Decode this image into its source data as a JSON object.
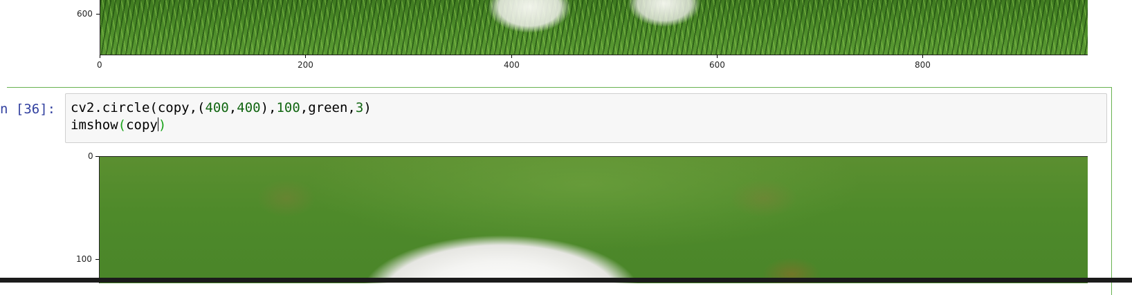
{
  "top_plot": {
    "y_tick_labels": [
      "600"
    ],
    "x_tick_labels": [
      "0",
      "200",
      "400",
      "600",
      "800"
    ]
  },
  "cell": {
    "prompt": "n [36]:",
    "line1_parts": {
      "p1": "cv2.circle(copy,(",
      "n1": "400",
      "c1": ",",
      "n2": "400",
      "p2": "),",
      "n3": "100",
      "p3": ",green,",
      "n4": "3",
      "p4": ")"
    },
    "line2_parts": {
      "func": "imshow",
      "open": "(",
      "arg": "copy",
      "close": ")"
    }
  },
  "bottom_plot": {
    "y_tick_labels": [
      "0",
      "100"
    ]
  }
}
